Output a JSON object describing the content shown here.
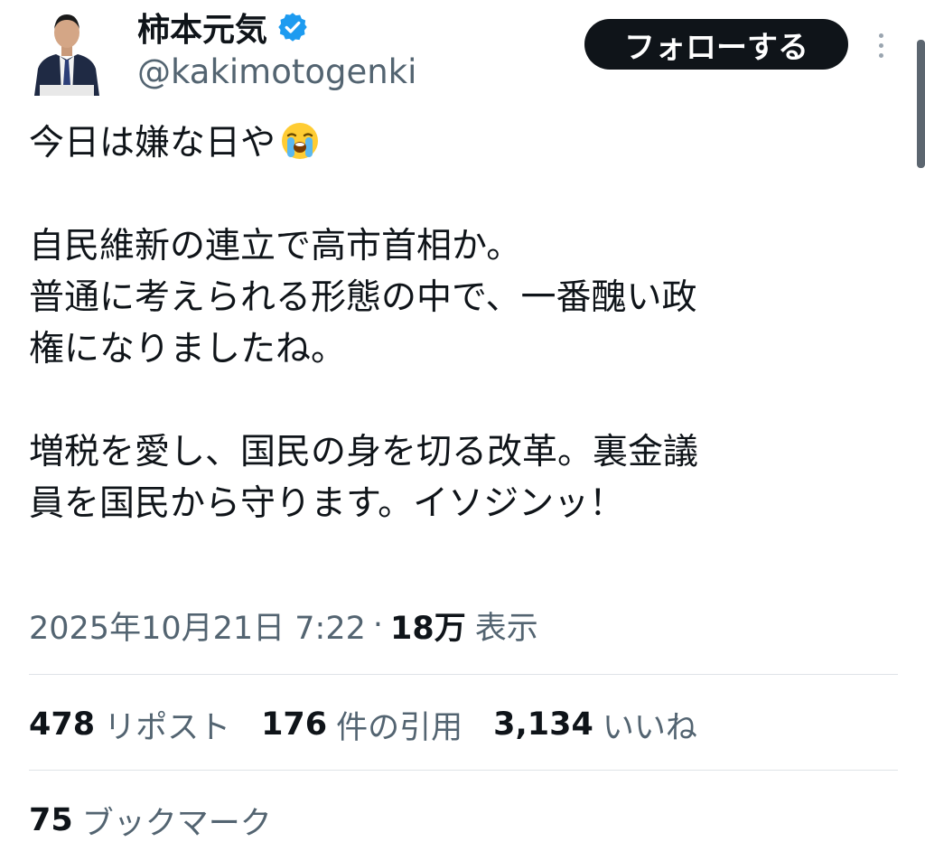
{
  "author": {
    "display_name": "柿本元気",
    "handle": "@kakimotogenki",
    "verified_icon": "verified-badge-icon",
    "verified_color": "#1d9bf0"
  },
  "actions": {
    "follow_label": "フォローする",
    "more_icon": "more-vertical-icon"
  },
  "tweet": {
    "lines": [
      "今日は嫌な日や",
      "",
      "自民維新の連立で高市首相か。",
      "普通に考えられる形態の中で、一番醜い政",
      "権になりましたね。",
      "",
      "増税を愛し、国民の身を切る改革。裏金議",
      "員を国民から守ります。イソジンッ！"
    ],
    "emoji": "loudly-crying-face-icon"
  },
  "meta": {
    "timestamp": "2025年10月21日 7:22",
    "separator": "·",
    "views_count": "18万",
    "views_label": "表示"
  },
  "stats": {
    "reposts": {
      "count": "478",
      "label": "リポスト"
    },
    "quotes": {
      "count": "176",
      "label": "件の引用"
    },
    "likes": {
      "count": "3,134",
      "label": "いいね"
    },
    "bookmarks": {
      "count": "75",
      "label": "ブックマーク"
    }
  },
  "colors": {
    "text_primary": "#0f1419",
    "text_secondary": "#536471",
    "button_bg": "#0f1419",
    "divider": "#dfe3e7"
  }
}
